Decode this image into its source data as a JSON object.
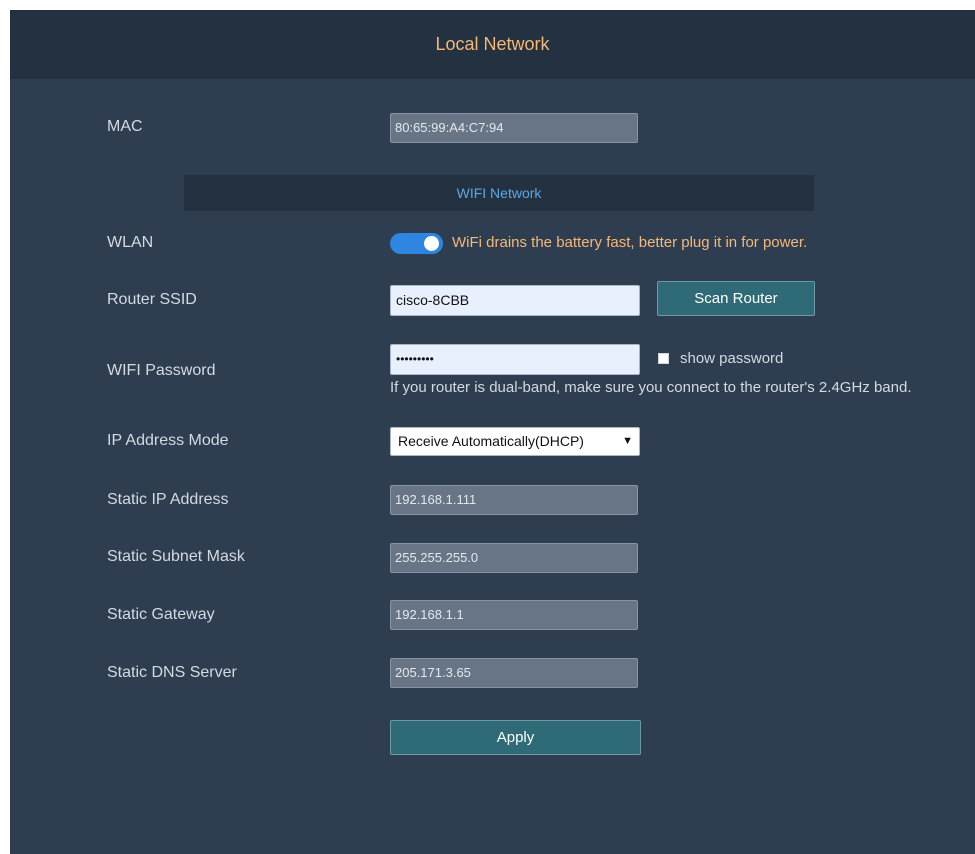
{
  "header": {
    "title": "Local Network"
  },
  "mac": {
    "label": "MAC",
    "value": "80:65:99:A4:C7:94"
  },
  "wifi_section": {
    "title": "WIFI Network"
  },
  "wlan": {
    "label": "WLAN",
    "enabled": true,
    "warning": "WiFi drains the battery fast, better plug it in for power."
  },
  "router_ssid": {
    "label": "Router SSID",
    "value": "cisco-8CBB",
    "scan_label": "Scan Router"
  },
  "wifi_password": {
    "label": "WIFI Password",
    "value": "•••••••••",
    "show_label": "show password",
    "hint": "If you router is dual-band, make sure you connect to the router's 2.4GHz band."
  },
  "ip_mode": {
    "label": "IP Address Mode",
    "selected": "Receive Automatically(DHCP)"
  },
  "static_ip": {
    "label": "Static IP Address",
    "value": "192.168.1.111"
  },
  "static_subnet": {
    "label": "Static Subnet Mask",
    "value": "255.255.255.0"
  },
  "static_gateway": {
    "label": "Static Gateway",
    "value": "192.168.1.1"
  },
  "static_dns": {
    "label": "Static DNS Server",
    "value": "205.171.3.65"
  },
  "apply": {
    "label": "Apply"
  },
  "colors": {
    "panel_bg": "#2e3e50",
    "header_bg": "#233140",
    "accent_orange": "#f4b878",
    "accent_blue": "#58a8e8",
    "toggle_blue": "#2f86e0",
    "button_teal": "#2f6b76"
  }
}
